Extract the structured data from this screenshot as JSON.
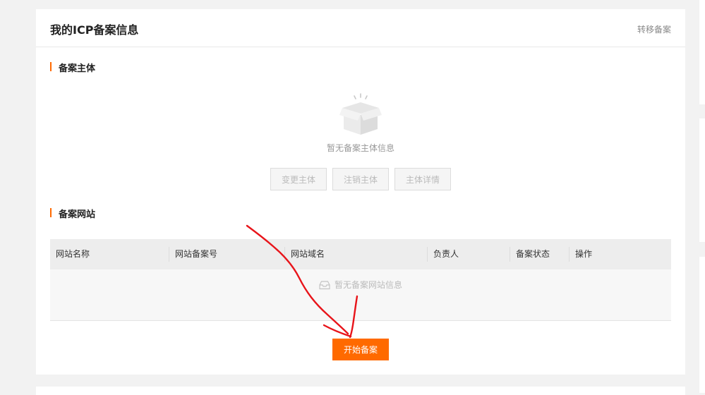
{
  "header": {
    "title": "我的ICP备案信息",
    "transfer_label": "转移备案"
  },
  "entity_section": {
    "title": "备案主体",
    "empty_text": "暂无备案主体信息",
    "buttons": [
      "变更主体",
      "注销主体",
      "主体详情"
    ]
  },
  "website_section": {
    "title": "备案网站",
    "columns": [
      "网站名称",
      "网站备案号",
      "网站域名",
      "负责人",
      "备案状态",
      "操作"
    ],
    "empty_text": "暂无备案网站信息"
  },
  "start_button": "开始备案",
  "colors": {
    "accent": "#ff6a00",
    "annotation": "#e8141a"
  },
  "icons": [
    "empty-box-icon",
    "empty-inbox-icon"
  ]
}
